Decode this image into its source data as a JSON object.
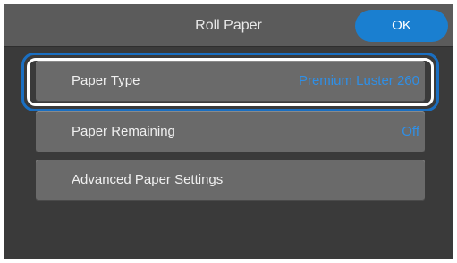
{
  "header": {
    "title": "Roll Paper",
    "ok_label": "OK"
  },
  "menu": {
    "items": [
      {
        "label": "Paper Type",
        "value": "Premium Luster 260"
      },
      {
        "label": "Paper Remaining",
        "value": "Off"
      },
      {
        "label": "Advanced Paper Settings",
        "value": ""
      }
    ],
    "selected_index": 0
  },
  "colors": {
    "accent": "#1a7fd0",
    "value_text": "#2f8fe6",
    "focus_ring": "#1a6fc2",
    "background": "#3a3a3a",
    "row": "#6a6a6a"
  }
}
